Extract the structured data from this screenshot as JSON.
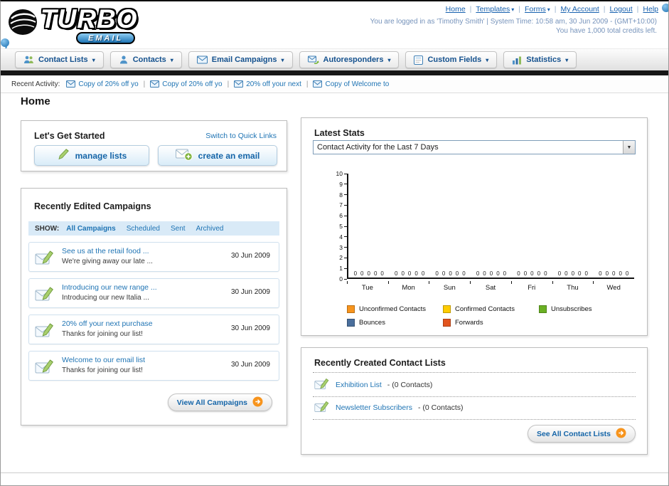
{
  "colors": {
    "accent_blue": "#1565a8",
    "link_blue": "#1f74b4",
    "nav_text": "#14518e",
    "black_bar": "#161616"
  },
  "header": {
    "logo_text": "TURBO",
    "logo_sub": "EMAIL",
    "links": [
      {
        "label": "Home",
        "caret": false
      },
      {
        "label": "Templates",
        "caret": true
      },
      {
        "label": "Forms",
        "caret": true
      },
      {
        "label": "My Account",
        "caret": false
      },
      {
        "label": "Logout",
        "caret": false
      },
      {
        "label": "Help",
        "caret": false
      }
    ],
    "login_info": "You are logged in as 'Timothy Smith' | System Time: 10:58 am, 30 Jun 2009 - (GMT+10:00)",
    "credits": "You have 1,000 total credits left."
  },
  "nav": {
    "items": [
      {
        "label": "Contact Lists",
        "icon": "contact-lists-icon"
      },
      {
        "label": "Contacts",
        "icon": "contacts-icon"
      },
      {
        "label": "Email Campaigns",
        "icon": "email-campaigns-icon"
      },
      {
        "label": "Autoresponders",
        "icon": "autoresponders-icon"
      },
      {
        "label": "Custom Fields",
        "icon": "custom-fields-icon"
      },
      {
        "label": "Statistics",
        "icon": "statistics-icon"
      }
    ]
  },
  "recent_activity": {
    "label": "Recent Activity:",
    "items": [
      "Copy of 20% off yo",
      "Copy of 20% off yo",
      "20% off your next",
      "Copy of Welcome to"
    ]
  },
  "page_title": "Home",
  "get_started": {
    "title": "Let's Get Started",
    "switch_link": "Switch to Quick Links",
    "manage_lists_label": "manage lists",
    "create_email_label": "create an email"
  },
  "campaigns": {
    "title": "Recently Edited Campaigns",
    "show_label": "SHOW:",
    "tabs": [
      {
        "label": "All Campaigns",
        "selected": true
      },
      {
        "label": "Scheduled",
        "selected": false
      },
      {
        "label": "Sent",
        "selected": false
      },
      {
        "label": "Archived",
        "selected": false
      }
    ],
    "items": [
      {
        "title": "See us at the retail food ...",
        "subtitle": "We're giving away our late ...",
        "date": "30 Jun 2009"
      },
      {
        "title": "Introducing our new range ...",
        "subtitle": "Introducing our new Italia ...",
        "date": "30 Jun 2009"
      },
      {
        "title": "20% off your next purchase",
        "subtitle": "Thanks for joining our list!",
        "date": "30 Jun 2009"
      },
      {
        "title": "Welcome to our email list",
        "subtitle": "Thanks for joining our list!",
        "date": "30 Jun 2009"
      }
    ],
    "view_all_label": "View All Campaigns"
  },
  "stats": {
    "title": "Latest Stats",
    "dropdown_value": "Contact Activity for the Last 7 Days",
    "chart_data": {
      "type": "bar",
      "title": "Contact Activity for the Last 7 Days",
      "categories": [
        "Tue",
        "Mon",
        "Sun",
        "Sat",
        "Fri",
        "Thu",
        "Wed"
      ],
      "series": [
        {
          "name": "Unconfirmed Contacts",
          "color": "#f7941d",
          "values": [
            0,
            0,
            0,
            0,
            0,
            0,
            0
          ]
        },
        {
          "name": "Confirmed Contacts",
          "color": "#ffcc00",
          "values": [
            0,
            0,
            0,
            0,
            0,
            0,
            0
          ]
        },
        {
          "name": "Unsubscribes",
          "color": "#6ab023",
          "values": [
            0,
            0,
            0,
            0,
            0,
            0,
            0
          ]
        },
        {
          "name": "Bounces",
          "color": "#4a6f9c",
          "values": [
            0,
            0,
            0,
            0,
            0,
            0,
            0
          ]
        },
        {
          "name": "Forwards",
          "color": "#e2541e",
          "values": [
            0,
            0,
            0,
            0,
            0,
            0,
            0
          ]
        }
      ],
      "ylim": [
        0,
        10
      ],
      "y_tick_step": 1,
      "grid": false,
      "legend_position": "bottom",
      "value_labels_shown": true
    }
  },
  "contact_lists": {
    "title": "Recently Created Contact Lists",
    "items": [
      {
        "name": "Exhibition List",
        "detail": "- (0 Contacts)"
      },
      {
        "name": "Newsletter Subscribers",
        "detail": "- (0 Contacts)"
      }
    ],
    "see_all_label": "See All Contact Lists"
  }
}
